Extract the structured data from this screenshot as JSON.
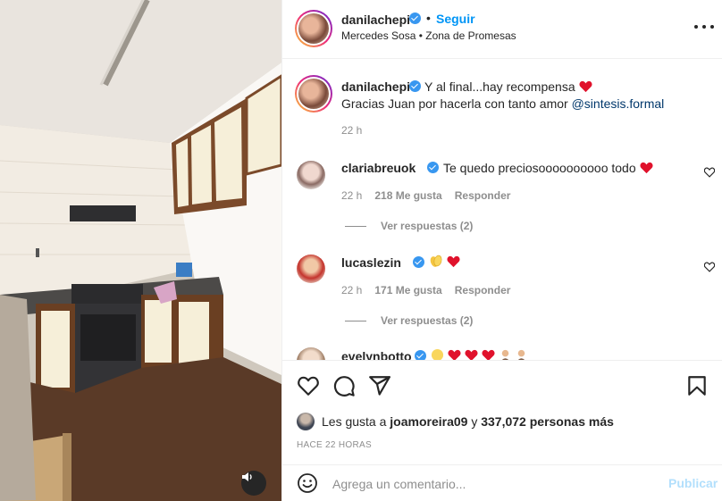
{
  "header": {
    "username": "danilachepi",
    "follow_label": "Seguir",
    "separator": "•",
    "subtitle": "Mercedes Sosa • Zona de Promesas"
  },
  "caption": {
    "username": "danilachepi",
    "text_line1": "Y al final...hay recompensa",
    "text_line2_prefix": "Gracias Juan por hacerla con tanto amor",
    "mention": "@sintesis.formal",
    "time": "22 h"
  },
  "comments": [
    {
      "username": "clariabreuok",
      "text": "Te quedo preciosoooooooooo todo",
      "emojis": [
        "heart-red"
      ],
      "time": "22 h",
      "likes": "218 Me gusta",
      "reply_label": "Responder",
      "view_replies": "Ver respuestas (2)"
    },
    {
      "username": "lucaslezin",
      "text": "",
      "emojis": [
        "clapping-hands",
        "heart-red"
      ],
      "time": "22 h",
      "likes": "171 Me gusta",
      "reply_label": "Responder",
      "view_replies": "Ver respuestas (2)"
    },
    {
      "username": "evelynbotto",
      "text": "",
      "emojis": [
        "smiling-face",
        "heart-red",
        "heart-red",
        "heart-red",
        "person",
        "person"
      ],
      "partially_visible": true
    }
  ],
  "actions": {
    "icons": [
      "heart-outline-icon",
      "comment-icon",
      "share-icon",
      "bookmark-icon"
    ]
  },
  "likes": {
    "prefix": "Les gusta a",
    "user": "joamoreira09",
    "connector": "y",
    "count": "337,072 personas más"
  },
  "timestamp": "HACE 22 HORAS",
  "add_comment": {
    "placeholder": "Agrega un comentario...",
    "post_label": "Publicar"
  },
  "colors": {
    "accent": "#0095f6",
    "verified": "#3897f0",
    "muted": "#8e8e8e",
    "mention": "#00376b",
    "heart": "#ed4956",
    "post_disabled": "#b2dffc"
  }
}
